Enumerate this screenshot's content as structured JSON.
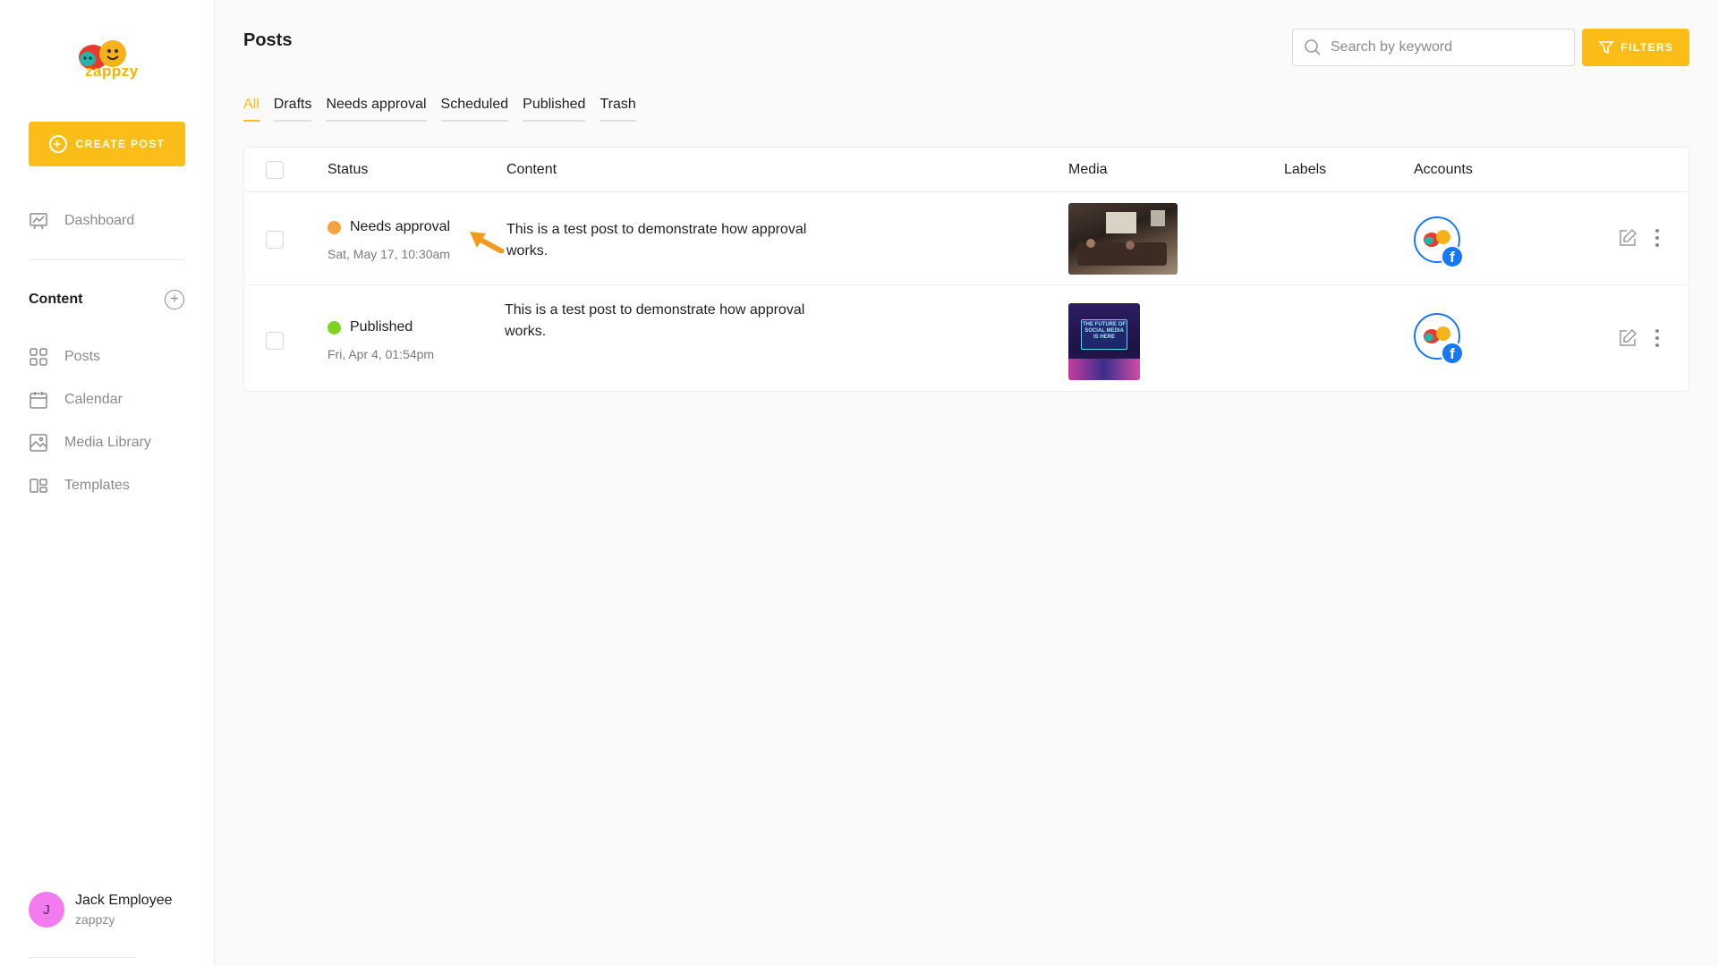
{
  "sidebar": {
    "logo_text": "zappzy",
    "create_post_label": "CREATE POST",
    "nav_top": [
      {
        "label": "Dashboard",
        "icon": "dashboard-icon"
      }
    ],
    "section_title": "Content",
    "nav_content": [
      {
        "label": "Posts",
        "icon": "grid-icon"
      },
      {
        "label": "Calendar",
        "icon": "calendar-icon"
      },
      {
        "label": "Media Library",
        "icon": "image-icon"
      },
      {
        "label": "Templates",
        "icon": "templates-icon"
      }
    ],
    "user": {
      "initial": "J",
      "name": "Jack Employee",
      "org": "zappzy"
    }
  },
  "header": {
    "title": "Posts",
    "search_placeholder": "Search by keyword",
    "filters_label": "FILTERS"
  },
  "tabs": [
    {
      "label": "All",
      "active": true
    },
    {
      "label": "Drafts"
    },
    {
      "label": "Needs approval"
    },
    {
      "label": "Scheduled"
    },
    {
      "label": "Published"
    },
    {
      "label": "Trash"
    }
  ],
  "table": {
    "columns": [
      "Status",
      "Content",
      "Media",
      "Labels",
      "Accounts"
    ],
    "rows": [
      {
        "status": "Needs approval",
        "status_color": "#f7a23c",
        "date": "Sat, May 17, 10:30am",
        "content": "This is a test post to demonstrate how approval works.",
        "media_text": "",
        "account": "facebook"
      },
      {
        "status": "Published",
        "status_color": "#7ed321",
        "date": "Fri, Apr 4, 01:54pm",
        "content": "This is a test post to demonstrate how approval works.",
        "media_text": "THE FUTURE OF SOCIAL MEDIA IS HERE",
        "account": "facebook"
      }
    ]
  },
  "colors": {
    "accent": "#fbbd17",
    "annotation_arrow": "#f39a1e",
    "facebook": "#1877f2"
  }
}
